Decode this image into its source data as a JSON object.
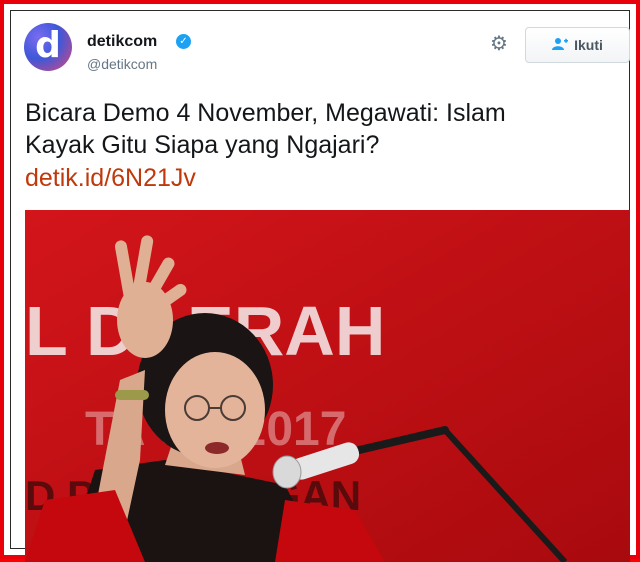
{
  "account": {
    "name": "detikcom",
    "handle": "@detikcom",
    "avatar_letter": "d",
    "verified_icon": "verified-badge-icon"
  },
  "actions": {
    "settings_icon": "gear-icon",
    "follow_label": "Ikuti",
    "follow_icon": "add-user-icon"
  },
  "tweet": {
    "text_line1": "Bicara Demo 4 November, Megawati: Islam",
    "text_line2": "Kayak Gitu Siapa yang Ngajari?",
    "link": "detik.id/6N21Jv"
  },
  "photo": {
    "banner_text_top": "L DAERAH",
    "banner_text_mid": "TA   UN 2017",
    "banner_text_bottom": "D   PERJUANGAN"
  },
  "colors": {
    "frame": "#e8000b",
    "link": "#c0390b",
    "accent": "#1da1f2",
    "photo_bg": "#c80c10"
  }
}
